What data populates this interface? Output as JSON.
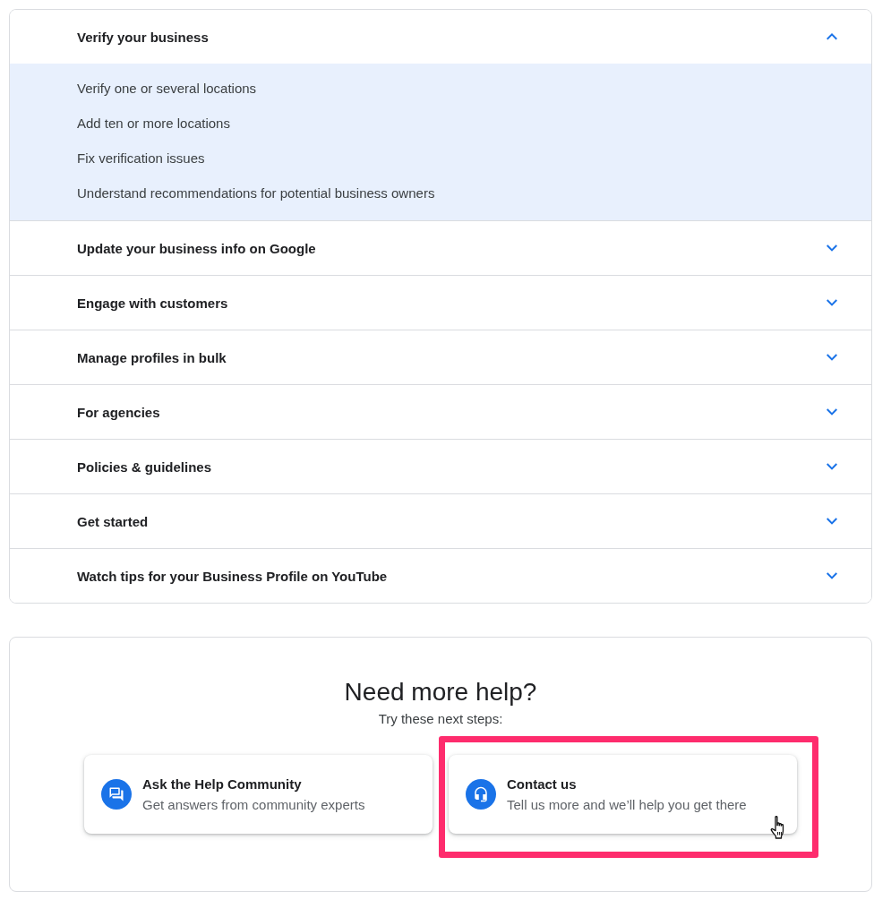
{
  "topics": [
    {
      "title": "Verify your business",
      "expanded": true,
      "links": [
        "Verify one or several locations",
        "Add ten or more locations",
        "Fix verification issues",
        "Understand recommendations for potential business owners"
      ]
    },
    {
      "title": "Update your business info on Google",
      "expanded": false
    },
    {
      "title": "Engage with customers",
      "expanded": false
    },
    {
      "title": "Manage profiles in bulk",
      "expanded": false
    },
    {
      "title": "For agencies",
      "expanded": false
    },
    {
      "title": "Policies & guidelines",
      "expanded": false
    },
    {
      "title": "Get started",
      "expanded": false
    },
    {
      "title": "Watch tips for your Business Profile on YouTube",
      "expanded": false
    }
  ],
  "help": {
    "title": "Need more help?",
    "subtitle": "Try these next steps:",
    "options": [
      {
        "kind": "community",
        "title": "Ask the Help Community",
        "description": "Get answers from community experts",
        "highlighted": false,
        "hovered": false
      },
      {
        "kind": "contact",
        "title": "Contact us",
        "description": "Tell us more and we’ll help you get there",
        "highlighted": true,
        "hovered": true
      }
    ]
  }
}
